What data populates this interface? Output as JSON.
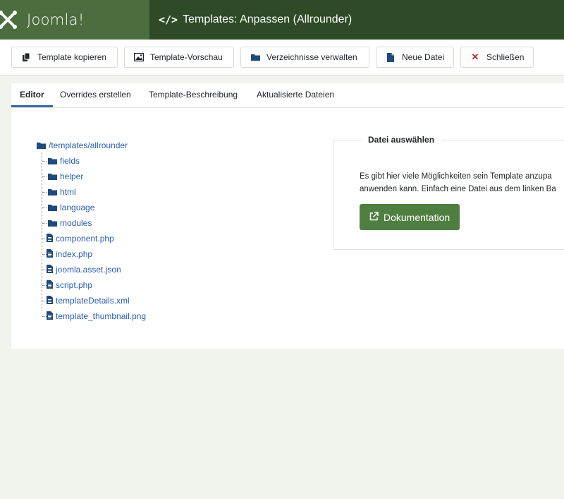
{
  "header": {
    "brand": "Joomla!",
    "title": "Templates: Anpassen (Allrounder)"
  },
  "toolbar": {
    "copy_label": "Template kopieren",
    "preview_label": "Template-Vorschau",
    "folders_label": "Verzeichnisse verwalten",
    "newfile_label": "Neue Datei",
    "close_label": "Schließen"
  },
  "tabs": [
    "Editor",
    "Overrides erstellen",
    "Template-Beschreibung",
    "Aktualisierte Dateien"
  ],
  "tree": {
    "root": "/templates/allrounder",
    "items": [
      {
        "type": "folder",
        "name": "fields"
      },
      {
        "type": "folder",
        "name": "helper"
      },
      {
        "type": "folder",
        "name": "html"
      },
      {
        "type": "folder",
        "name": "language"
      },
      {
        "type": "folder",
        "name": "modules"
      },
      {
        "type": "file",
        "name": "component.php"
      },
      {
        "type": "file",
        "name": "index.php"
      },
      {
        "type": "file",
        "name": "joomla.asset.json"
      },
      {
        "type": "file",
        "name": "script.php"
      },
      {
        "type": "file",
        "name": "templateDetails.xml"
      },
      {
        "type": "file",
        "name": "template_thumbnail.png"
      }
    ]
  },
  "file_select": {
    "legend": "Datei auswählen",
    "line1": "Es gibt hier viele Möglichkeiten sein Template anzupa",
    "line2": "anwenden kann. Einfach eine Datei aus dem linken Ba",
    "doc_button": "Dokumentation"
  },
  "colors": {
    "brand_green": "#4c6d3d",
    "title_green": "#2e4a26",
    "doc_button": "#4f7e41",
    "link_blue": "#2a5db0",
    "close_red": "#c52827",
    "folder_blue": "#1f4a7a"
  }
}
